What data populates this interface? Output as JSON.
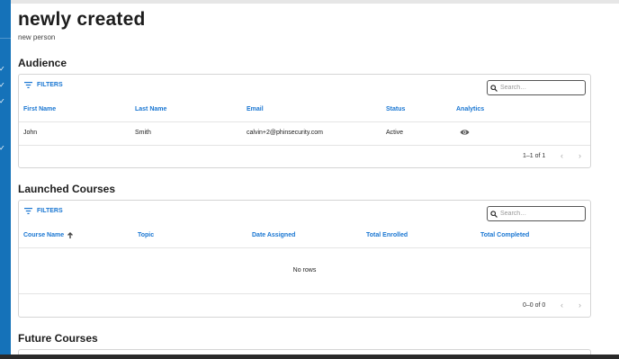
{
  "page": {
    "title": "newly created",
    "subtitle": "new person"
  },
  "audience": {
    "section_title": "Audience",
    "filters_label": "FILTERS",
    "search_placeholder": "Search…",
    "columns": [
      "First Name",
      "Last Name",
      "Email",
      "Status",
      "Analytics"
    ],
    "rows": [
      {
        "first_name": "John",
        "last_name": "Smith",
        "email": "calvin+2@phinsecurity.com",
        "status": "Active",
        "analytics_icon": "eye-icon"
      }
    ],
    "pagination": "1–1 of 1"
  },
  "launched": {
    "section_title": "Launched Courses",
    "filters_label": "FILTERS",
    "search_placeholder": "Search…",
    "columns": [
      "Course Name",
      "Topic",
      "Date Assigned",
      "Total Enrolled",
      "Total Completed"
    ],
    "sort_icon": "arrow-up-icon",
    "empty_text": "No rows",
    "pagination": "0–0 of 0"
  },
  "future": {
    "section_title": "Future Courses"
  },
  "colors": {
    "sidebar": "#1572b9",
    "accent": "#1976d2"
  }
}
